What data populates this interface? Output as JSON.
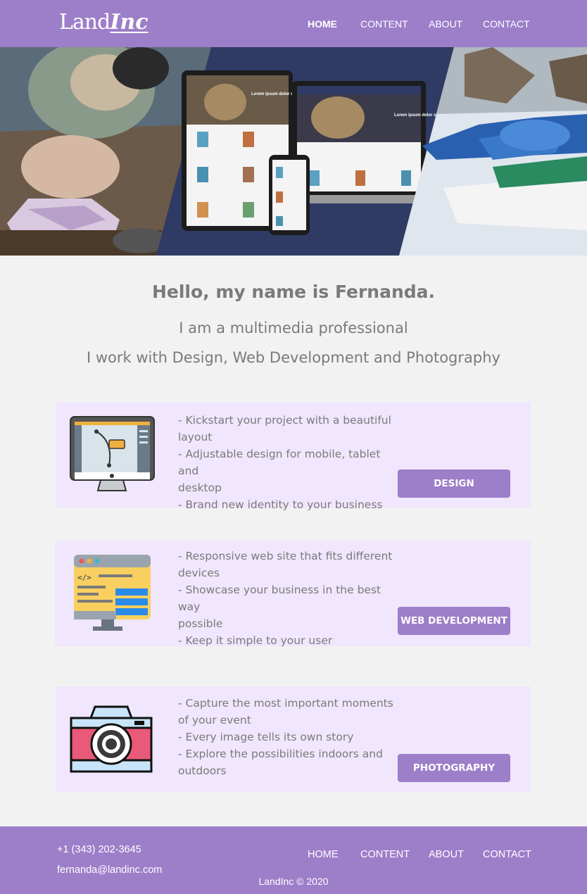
{
  "brand": {
    "part1": "Land",
    "part2": "Inc"
  },
  "nav": [
    {
      "label": "HOME",
      "active": true
    },
    {
      "label": "CONTENT",
      "active": false
    },
    {
      "label": "ABOUT",
      "active": false
    },
    {
      "label": "CONTACT",
      "active": false
    }
  ],
  "hero": {
    "laptop_heading": "Lorem ipsum dolor sit amet",
    "tablet_heading": "Lorem ipsum dolor sit amet"
  },
  "intro": {
    "title": "Hello, my name is Fernanda.",
    "line1": "I am a multimedia professional",
    "line2": "I work with Design, Web Development and Photography"
  },
  "services": [
    {
      "icon": "monitor-pen-tool-icon",
      "lines": [
        "- Kickstart your project with a beautiful",
        "layout",
        "- Adjustable design for mobile, tablet and",
        "desktop",
        "- Brand new identity to your business"
      ],
      "button": "DESIGN"
    },
    {
      "icon": "code-window-icon",
      "lines": [
        "- Responsive web site that fits different",
        "devices",
        "- Showcase your business in the best way",
        "possible",
        "- Keep it simple to your user"
      ],
      "button": "WEB DEVELOPMENT"
    },
    {
      "icon": "camera-icon",
      "lines": [
        "- Capture the most important moments",
        "of your event",
        "- Every image tells its own story",
        "- Explore the possibilities indoors and",
        "outdoors"
      ],
      "button": "PHOTOGRAPHY"
    }
  ],
  "footer": {
    "phone": "+1 (343) 202-3645",
    "email": "fernanda@landinc.com",
    "nav": [
      "HOME",
      "CONTENT",
      "ABOUT",
      "CONTACT"
    ],
    "copyright": "LandInc © 2020"
  },
  "colors": {
    "accent": "#9d7ec9",
    "card": "#f0e6fd",
    "text": "#7a7a7a",
    "page": "#f2f2f2"
  }
}
